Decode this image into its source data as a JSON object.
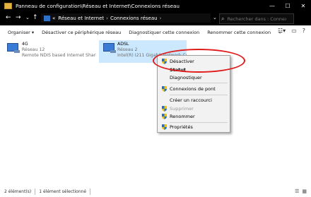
{
  "window": {
    "title": "Panneau de configuration\\Réseau et Internet\\Connexions réseau",
    "minimize_icon": "minimize-icon",
    "maximize_icon": "maximize-icon",
    "close_icon": "close-icon"
  },
  "addressbar": {
    "back": "←",
    "forward": "→",
    "down": "⌄",
    "up": "↑",
    "prefix": "«",
    "crumbs": [
      "Réseau et Internet",
      "Connexions réseau"
    ],
    "sep": "›",
    "dropdown": "⌄",
    "refresh": "↻",
    "search_placeholder": "Rechercher dans : Connexio..."
  },
  "toolbar": {
    "items": [
      "Organiser ▾",
      "Désactiver ce périphérique réseau",
      "Diagnostiquer cette connexion",
      "Renommer cette connexion",
      "»"
    ]
  },
  "connections": [
    {
      "name": "4G",
      "network": "Réseau 12",
      "device": "Remote NDIS based Internet Shari...",
      "selected": false
    },
    {
      "name": "ADSL",
      "network": "Réseau 2",
      "device": "Intel(R) I211 Gigabit Network Con...",
      "selected": true
    }
  ],
  "context_menu": {
    "items": [
      {
        "label": "Désactiver",
        "shield": true,
        "disabled": false,
        "bold": false
      },
      {
        "label": "Statut",
        "shield": false,
        "disabled": false,
        "bold": true
      },
      {
        "label": "Diagnostiquer",
        "shield": false,
        "disabled": false,
        "bold": false
      },
      {
        "label": "Connexions de pont",
        "shield": true,
        "disabled": false,
        "bold": false
      },
      {
        "label": "Créer un raccourci",
        "shield": false,
        "disabled": false,
        "bold": false
      },
      {
        "label": "Supprimer",
        "shield": true,
        "disabled": true,
        "bold": false
      },
      {
        "label": "Renommer",
        "shield": true,
        "disabled": false,
        "bold": false
      },
      {
        "label": "Propriétés",
        "shield": true,
        "disabled": false,
        "bold": false
      }
    ]
  },
  "status": {
    "count": "2 élément(s)",
    "selection": "1 élément sélectionné"
  },
  "colors": {
    "selection": "#cce8ff",
    "annotation": "#e01b1b"
  }
}
